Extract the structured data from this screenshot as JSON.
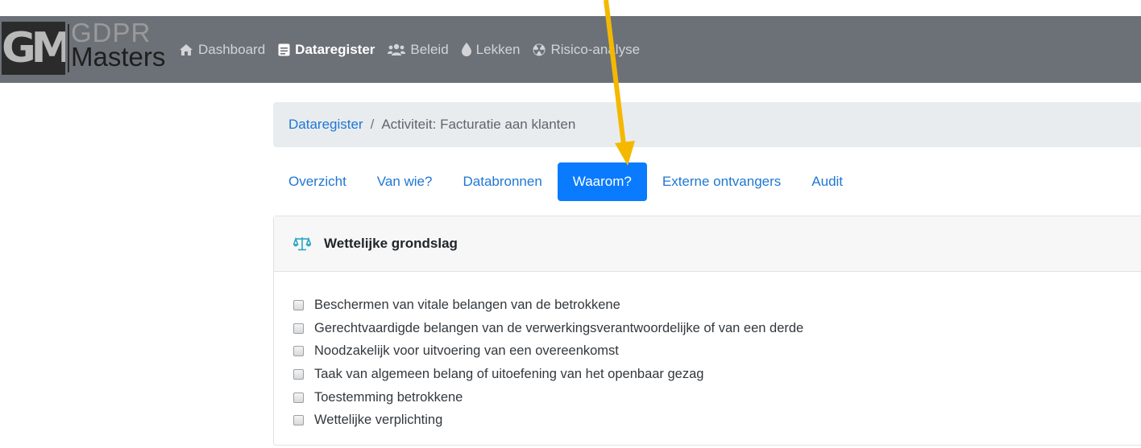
{
  "logo": {
    "mark": "GM",
    "line1": "GDPR",
    "line2": "Masters"
  },
  "nav": {
    "items": [
      {
        "label": "Dashboard",
        "icon": "home-icon",
        "active": false
      },
      {
        "label": "Dataregister",
        "icon": "register-icon",
        "active": true
      },
      {
        "label": "Beleid",
        "icon": "users-icon",
        "active": false
      },
      {
        "label": "Lekken",
        "icon": "drop-icon",
        "active": false
      },
      {
        "label": "Risico-analyse",
        "icon": "radiation-icon",
        "active": false
      }
    ]
  },
  "breadcrumb": {
    "link": "Dataregister",
    "separator": "/",
    "current": "Activiteit: Facturatie aan klanten"
  },
  "tabs": [
    {
      "label": "Overzicht",
      "active": false
    },
    {
      "label": "Van wie?",
      "active": false
    },
    {
      "label": "Databronnen",
      "active": false
    },
    {
      "label": "Waarom?",
      "active": true
    },
    {
      "label": "Externe ontvangers",
      "active": false
    },
    {
      "label": "Audit",
      "active": false
    }
  ],
  "card": {
    "icon": "scale-icon",
    "title": "Wettelijke grondslag",
    "options": [
      {
        "label": "Beschermen van vitale belangen van de betrokkene",
        "checked": false
      },
      {
        "label": "Gerechtvaardigde belangen van de verwerkingsverantwoordelijke of van een derde",
        "checked": false
      },
      {
        "label": "Noodzakelijk voor uitvoering van een overeenkomst",
        "checked": false
      },
      {
        "label": "Taak van algemeen belang of uitoefening van het openbaar gezag",
        "checked": false
      },
      {
        "label": "Toestemming betrokkene",
        "checked": false
      },
      {
        "label": "Wettelijke verplichting",
        "checked": false
      }
    ]
  },
  "colors": {
    "navbar": "#6c7178",
    "link": "#1f77d4",
    "active_tab": "#0a7bfe",
    "annotation_arrow": "#f5b800"
  }
}
